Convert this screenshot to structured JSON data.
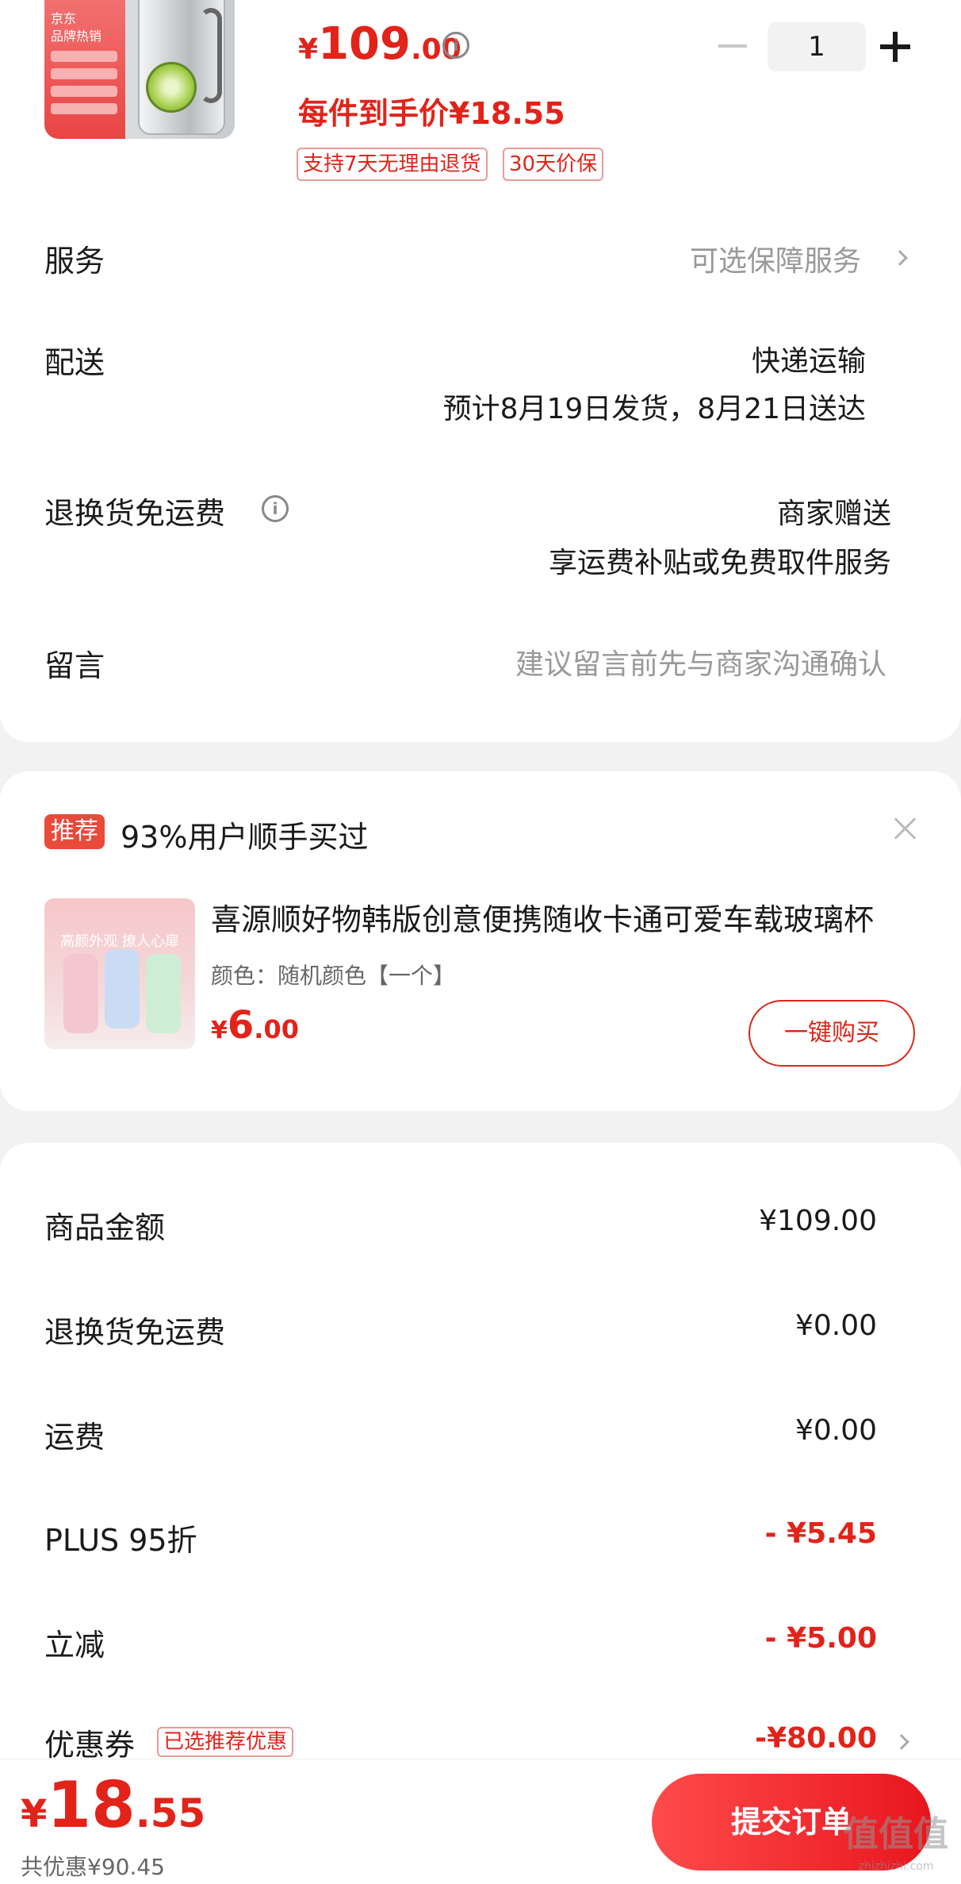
{
  "product": {
    "price_symbol": "¥",
    "price_int": "109",
    "price_dec": ".00",
    "net_price": "每件到手价¥18.55",
    "tags": [
      "支持7天无理由退货",
      "30天价保"
    ],
    "quantity": "1",
    "thumb_text": [
      "京东",
      "品牌热销"
    ]
  },
  "rows": {
    "service_label": "服务",
    "service_value": "可选保障服务",
    "delivery_label": "配送",
    "delivery_method": "快递运输",
    "delivery_eta": "预计8月19日发货，8月21日送达",
    "return_label": "退换货免运费",
    "return_value1": "商家赠送",
    "return_value2": "享运费补贴或免费取件服务",
    "message_label": "留言",
    "message_placeholder": "建议留言前先与商家沟通确认"
  },
  "recommend": {
    "badge": "推荐",
    "title": "93%用户顺手买过",
    "item_name": "喜源顺好物韩版创意便携随收卡通可爱车载玻璃杯",
    "item_color": "颜色：随机颜色【一个】",
    "price_symbol": "¥",
    "price_int": "6",
    "price_dec": ".00",
    "buy_label": "一键购买",
    "thumb_text": "高颜外观 撩人心扉"
  },
  "summary": {
    "goods_label": "商品金额",
    "goods_value": "¥109.00",
    "return_label": "退换货免运费",
    "return_value": "¥0.00",
    "shipping_label": "运费",
    "shipping_value": "¥0.00",
    "plus_label": "PLUS 95折",
    "plus_value": "- ¥5.45",
    "instant_label": "立减",
    "instant_value": "- ¥5.00",
    "coupon_label": "优惠券",
    "coupon_tag": "已选推荐优惠",
    "coupon_value": "-¥80.00"
  },
  "footer": {
    "total_symbol": "¥",
    "total_int": "18",
    "total_dec": ".55",
    "saved": "共优惠¥90.45",
    "submit_label": "提交订单",
    "watermark": "值值值",
    "watermark_sub": "zhizhizhi.com"
  },
  "colors": {
    "accent": "#e2231a",
    "background": "#f2f2f2"
  }
}
